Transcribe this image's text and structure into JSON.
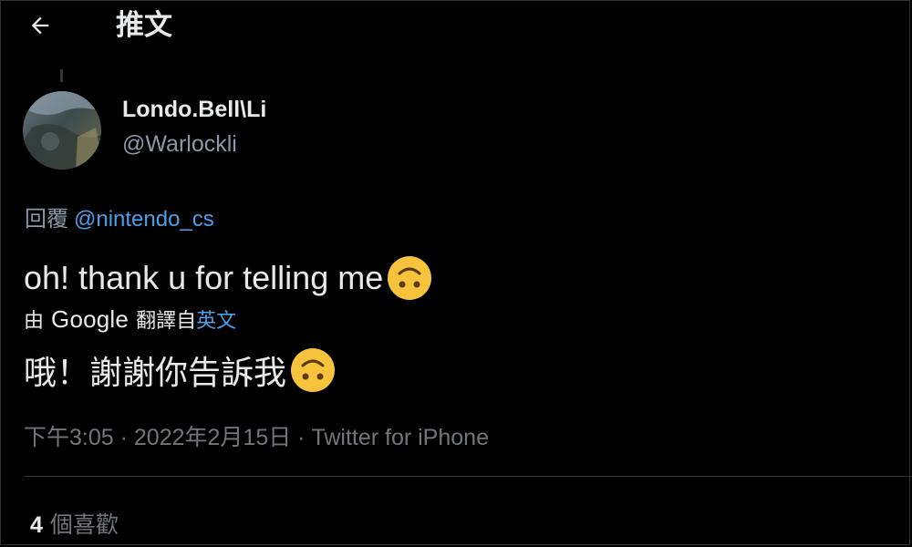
{
  "header": {
    "back_icon": "arrow-left-icon",
    "title": "推文"
  },
  "author": {
    "name": "Londo.Bell\\Li",
    "handle": "@Warlockli",
    "avatar": "avatar-image"
  },
  "reply": {
    "prefix": "回覆",
    "mention": "@nintendo_cs"
  },
  "tweet": {
    "text": "oh! thank u for telling me",
    "emoji": "upside-down-face-emoji"
  },
  "translation": {
    "by": "由",
    "provider": "Google",
    "from": "翻譯自",
    "language": "英文",
    "text": "哦！謝謝你告訴我"
  },
  "meta": {
    "time": "下午3:05",
    "sep1": " · ",
    "date": "2022年2月15日",
    "sep2": " · ",
    "source": "Twitter for iPhone"
  },
  "likes": {
    "count": "4",
    "label": "個喜歡"
  },
  "colors": {
    "background": "#000000",
    "text": "#e7e9ea",
    "muted": "#71767b",
    "link": "#4a9fe8",
    "emoji": "#f7c33c"
  }
}
